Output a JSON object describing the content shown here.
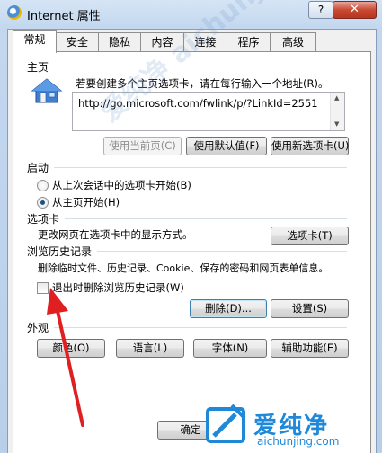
{
  "window": {
    "title": "Internet 属性",
    "help_label": "?",
    "close_label": "✕"
  },
  "tabs": [
    {
      "label": "常规",
      "active": true
    },
    {
      "label": "安全",
      "active": false
    },
    {
      "label": "隐私",
      "active": false
    },
    {
      "label": "内容",
      "active": false
    },
    {
      "label": "连接",
      "active": false
    },
    {
      "label": "程序",
      "active": false
    },
    {
      "label": "高级",
      "active": false
    }
  ],
  "homepage": {
    "group_label": "主页",
    "description": "若要创建多个主页选项卡，请在每行输入一个地址(R)。",
    "value": "http://go.microsoft.com/fwlink/p/?LinkId=2551",
    "use_current_label": "使用当前页(C)",
    "use_default_label": "使用默认值(F)",
    "use_new_tab_label": "使用新选项卡(U)"
  },
  "startup": {
    "group_label": "启动",
    "option_last_session": "从上次会话中的选项卡开始(B)",
    "option_home_page": "从主页开始(H)",
    "selected": "option_home_page"
  },
  "tabs_section": {
    "group_label": "选项卡",
    "description": "更改网页在选项卡中的显示方式。",
    "button_label": "选项卡(T)"
  },
  "history": {
    "group_label": "浏览历史记录",
    "description": "删除临时文件、历史记录、Cookie、保存的密码和网页表单信息。",
    "checkbox_label": "退出时删除浏览历史记录(W)",
    "checkbox_checked": false,
    "delete_label": "删除(D)...",
    "settings_label": "设置(S)"
  },
  "appearance": {
    "group_label": "外观",
    "colors_label": "颜色(O)",
    "languages_label": "语言(L)",
    "fonts_label": "字体(N)",
    "accessibility_label": "辅助功能(E)"
  },
  "footer": {
    "ok_label": "确定"
  },
  "watermark": {
    "brand": "爱纯净",
    "url": "aichunjing.com",
    "diagonal": "爱纯净 aichunjing"
  },
  "colors": {
    "arrow": "#e02020",
    "watermark": "#1f88d8",
    "close_button": "#c84a32"
  }
}
